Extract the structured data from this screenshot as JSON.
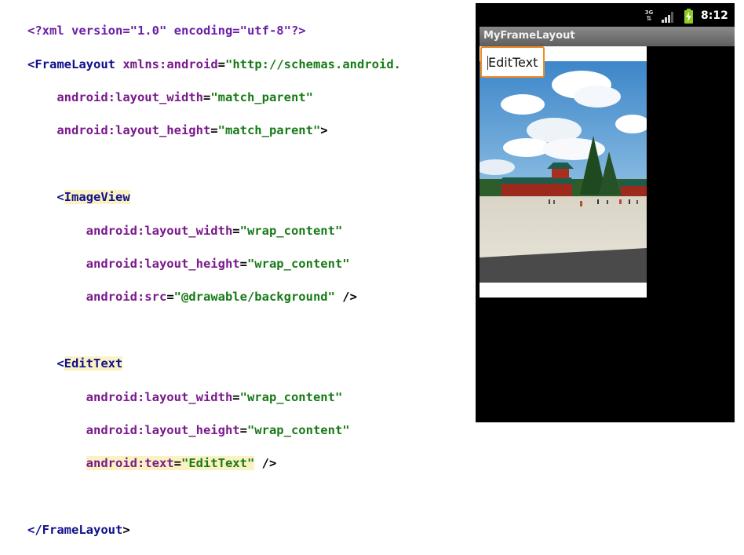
{
  "code": {
    "xml_decl": "<?xml version=\"1.0\" encoding=\"utf-8\"?>",
    "frame_open_tag": "FrameLayout",
    "frame_xmlns_attr": "xmlns:android",
    "frame_xmlns_val": "\"http://schemas.android.",
    "frame_width_attr": "android:layout_width",
    "frame_width_val": "\"match_parent\"",
    "frame_height_attr": "android:layout_height",
    "frame_height_val": "\"match_parent\"",
    "image_tag": "ImageView",
    "image_width_attr": "android:layout_width",
    "image_width_val": "\"wrap_content\"",
    "image_height_attr": "android:layout_height",
    "image_height_val": "\"wrap_content\"",
    "image_src_attr": "android:src",
    "image_src_val": "\"@drawable/background\"",
    "edit_tag": "EditText",
    "edit_width_attr": "android:layout_width",
    "edit_width_val": "\"wrap_content\"",
    "edit_height_attr": "android:layout_height",
    "edit_height_val": "\"wrap_content\"",
    "edit_text_attr": "android:text",
    "edit_text_val": "\"EditText\"",
    "frame_close_tag": "FrameLayout"
  },
  "phone": {
    "status": {
      "network_label": "3G",
      "signal_icon": "signal-bars-icon",
      "battery_icon": "battery-charging-icon",
      "time": "8:12"
    },
    "app_title": "MyFrameLayout",
    "edittext_value": "EditText",
    "colors": {
      "edittext_focus_border": "#f08b25",
      "battery": "#8ccd1d",
      "titlebar": "#6e6e6e"
    }
  }
}
